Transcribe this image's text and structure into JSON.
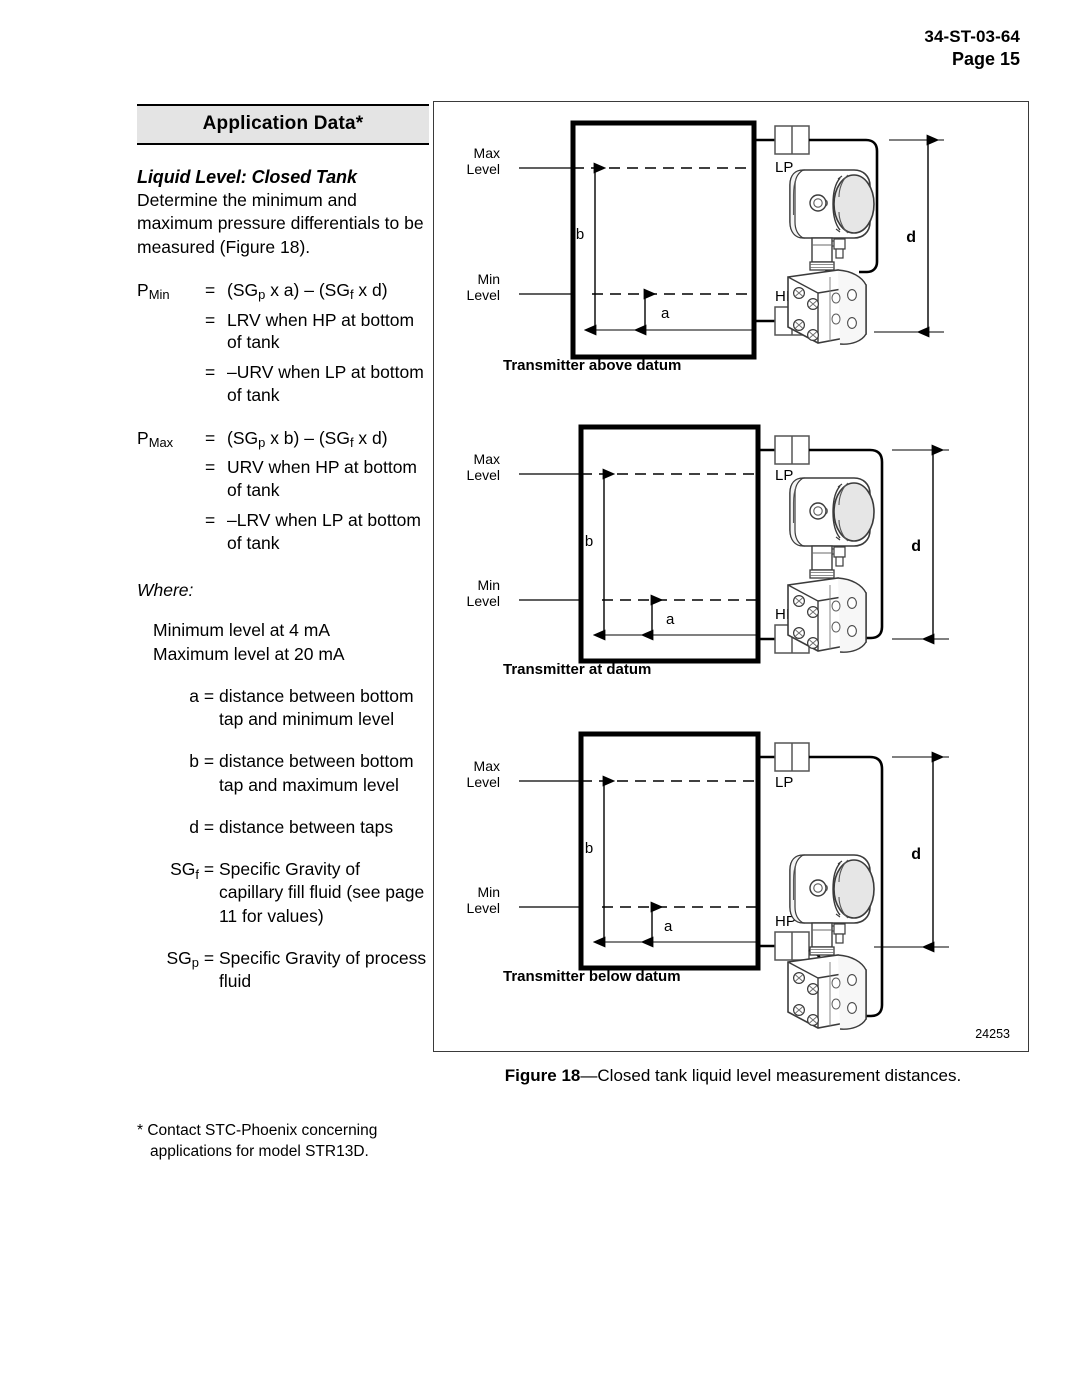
{
  "header": {
    "doc_id": "34-ST-03-64",
    "page_label": "Page 15"
  },
  "section": {
    "title": "Application Data*",
    "subhead": "Liquid Level: Closed Tank",
    "intro": "Determine the minimum and maximum pressure differentials to be measured (Figure 18)."
  },
  "formulas": {
    "pmin": {
      "symbol_base": "P",
      "symbol_sub": "Min",
      "equals": "=",
      "expr_a": "(SG",
      "expr_a_sub": "p",
      "expr_a_tail": " x a) – (SG",
      "expr_a_sub2": "f",
      "expr_a_tail2": " x d)",
      "lines": [
        {
          "eq": "=",
          "text": "LRV when HP at bottom of tank"
        },
        {
          "eq": "=",
          "text": "–URV when LP at bottom of tank"
        }
      ]
    },
    "pmax": {
      "symbol_base": "P",
      "symbol_sub": "Max",
      "equals": "=",
      "expr_a": "(SG",
      "expr_a_sub": "p",
      "expr_a_tail": " x b) – (SG",
      "expr_a_sub2": "f",
      "expr_a_tail2": " x d)",
      "lines": [
        {
          "eq": "=",
          "text": "URV when HP at bottom of tank"
        },
        {
          "eq": "=",
          "text": "–LRV when LP at bottom of tank"
        }
      ]
    }
  },
  "where": {
    "label": "Where:",
    "notes": [
      "Minimum level at 4 mA",
      "Maximum level at 20 mA"
    ],
    "definitions": [
      {
        "term": "a",
        "eq": "=",
        "desc": "distance between bottom tap and minimum level"
      },
      {
        "term": "b",
        "eq": "=",
        "desc": "distance between bottom tap and maximum level"
      },
      {
        "term": "d",
        "eq": "=",
        "desc": "distance between taps"
      },
      {
        "term": "SG",
        "term_sub": "f",
        "eq": "=",
        "desc": "Specific Gravity of capillary fill fluid (see page 11 for values)"
      },
      {
        "term": "SG",
        "term_sub": "p",
        "eq": "=",
        "desc": "Specific Gravity of process fluid"
      }
    ]
  },
  "figure": {
    "drawing_number": "24253",
    "caption_bold": "Figure 18",
    "caption_text": "—Closed tank liquid level measurement distances.",
    "panels": [
      {
        "caption": "Transmitter above datum",
        "max_label_line1": "Max",
        "max_label_line2": "Level",
        "min_label_line1": "Min",
        "min_label_line2": "Level",
        "dim_b": "b",
        "dim_a": "a",
        "dim_d": "d",
        "tap_lp": "LP",
        "tap_hp": "HP"
      },
      {
        "caption": "Transmitter at datum",
        "max_label_line1": "Max",
        "max_label_line2": "Level",
        "min_label_line1": "Min",
        "min_label_line2": "Level",
        "dim_b": "b",
        "dim_a": "a",
        "dim_d": "d",
        "tap_lp": "LP",
        "tap_hp": "HP"
      },
      {
        "caption": "Transmitter below datum",
        "max_label_line1": "Max",
        "max_label_line2": "Level",
        "min_label_line1": "Min",
        "min_label_line2": "Level",
        "dim_b": "b",
        "dim_a": "a",
        "dim_d": "d",
        "tap_lp": "LP",
        "tap_hp": "HP"
      }
    ]
  },
  "footnote": {
    "line1": "* Contact STC-Phoenix concerning",
    "line2": "applications for model STR13D."
  }
}
